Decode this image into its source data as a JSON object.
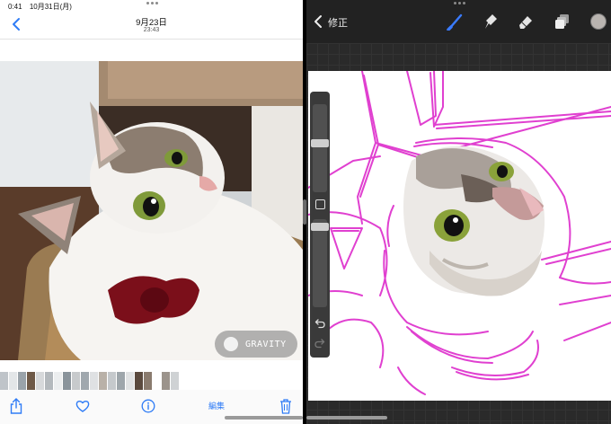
{
  "photos": {
    "status": {
      "time": "0:41",
      "date": "10月31日(月)"
    },
    "nav": {
      "date": "9月23日",
      "time": "23:43"
    },
    "watermark": "GRAVITY",
    "toolbar": {
      "edit_label": "編集"
    },
    "colors": {
      "accent": "#2f7cf6"
    }
  },
  "procreate": {
    "title": "修正",
    "tools": [
      "brush-icon",
      "smudge-icon",
      "eraser-icon",
      "layers-icon",
      "color-icon"
    ],
    "colors": {
      "sketch": "#e040d0",
      "brush": "#3a7bff",
      "color_well": "#b9b4b0"
    }
  }
}
